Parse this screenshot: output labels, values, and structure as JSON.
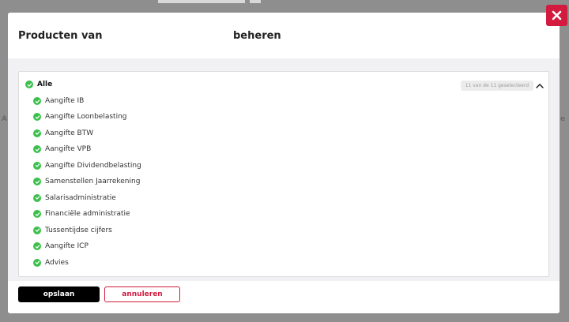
{
  "modal": {
    "title_left": "Producten van",
    "title_right": "beheren",
    "close_icon": "close-icon",
    "colors": {
      "accent": "#d21b3f",
      "check": "#3cc04d",
      "save": "#000000"
    }
  },
  "products": {
    "all_label": "Alle",
    "count_label": "11 van de 11 geselecteerd",
    "items": [
      "Aangifte IB",
      "Aangifte Loonbelasting",
      "Aangifte BTW",
      "Aangifte VPB",
      "Aangifte Dividendbelasting",
      "Samenstellen Jaarrekening",
      "Salarisadministratie",
      "Financiële administratie",
      "Tussentijdse cijfers",
      "Aangifte ICP",
      "Advies"
    ]
  },
  "footer": {
    "save_label": "opslaan",
    "cancel_label": "annuleren"
  }
}
